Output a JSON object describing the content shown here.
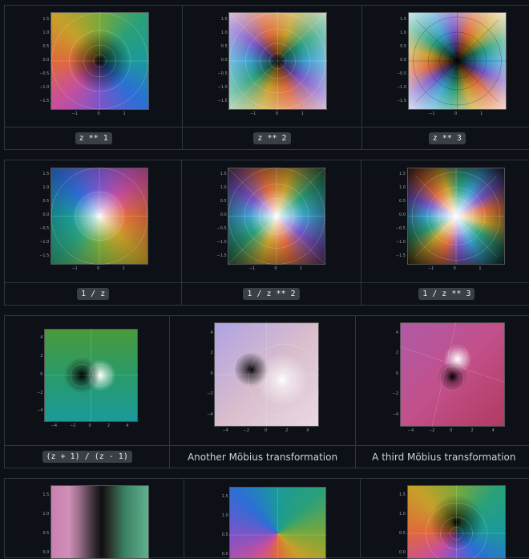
{
  "rows": [
    {
      "cells": [
        {
          "caption": "z ** 1",
          "code": true,
          "ticks_y": [
            "1.5",
            "1.0",
            "0.5",
            "0.0",
            "−0.5",
            "−1.0",
            "−1.5"
          ],
          "ticks_x": [
            "−1",
            "0",
            "1"
          ],
          "plot": "p1"
        },
        {
          "caption": "z ** 2",
          "code": true,
          "ticks_y": [
            "1.5",
            "1.0",
            "0.5",
            "0.0",
            "−0.5",
            "−1.0",
            "−1.5"
          ],
          "ticks_x": [
            "−1",
            "0",
            "1"
          ],
          "plot": "p2"
        },
        {
          "caption": "z ** 3",
          "code": true,
          "ticks_y": [
            "1.5",
            "1.0",
            "0.5",
            "0.0",
            "−0.5",
            "−1.0",
            "−1.5"
          ],
          "ticks_x": [
            "−1",
            "0",
            "1"
          ],
          "plot": "p3"
        }
      ]
    },
    {
      "cells": [
        {
          "caption": "1 / z",
          "code": true,
          "ticks_y": [
            "1.5",
            "1.0",
            "0.5",
            "0.0",
            "−0.5",
            "−1.0",
            "−1.5"
          ],
          "ticks_x": [
            "−1",
            "0",
            "1"
          ],
          "plot": "p4"
        },
        {
          "caption": "1 / z ** 2",
          "code": true,
          "ticks_y": [
            "1.5",
            "1.0",
            "0.5",
            "0.0",
            "−0.5",
            "−1.0",
            "−1.5"
          ],
          "ticks_x": [
            "−1",
            "0",
            "1"
          ],
          "plot": "p5"
        },
        {
          "caption": "1 / z ** 3",
          "code": true,
          "ticks_y": [
            "1.5",
            "1.0",
            "0.5",
            "0.0",
            "−0.5",
            "−1.0",
            "−1.5"
          ],
          "ticks_x": [
            "−1",
            "0",
            "1"
          ],
          "plot": "p6"
        }
      ]
    },
    {
      "cells": [
        {
          "caption": "(z + 1) / (z - 1)",
          "code": true,
          "ticks_y": [
            "4",
            "2",
            "0",
            "−2",
            "−4"
          ],
          "ticks_x": [
            "−4",
            "−2",
            "0",
            "2",
            "4"
          ],
          "plot": "p7"
        },
        {
          "caption": "Another Möbius transformation",
          "code": false,
          "ticks_y": [
            "4",
            "2",
            "0",
            "−2",
            "−4"
          ],
          "ticks_x": [
            "−4",
            "−2",
            "0",
            "2",
            "4"
          ],
          "plot": "p8"
        },
        {
          "caption": "A third Möbius transformation",
          "code": false,
          "ticks_y": [
            "4",
            "2",
            "0",
            "−2",
            "−4"
          ],
          "ticks_x": [
            "−4",
            "−2",
            "0",
            "2",
            "4"
          ],
          "plot": "p9"
        }
      ]
    },
    {
      "cells": [
        {
          "caption": "",
          "code": false,
          "ticks_y": [
            "1.5",
            "1.0",
            "0.5",
            "0.0",
            "−0.5"
          ],
          "ticks_x": [],
          "plot": "p10"
        },
        {
          "caption": "",
          "code": false,
          "ticks_y": [
            "1.5",
            "1.0",
            "0.5",
            "0.0",
            "−0.5"
          ],
          "ticks_x": [],
          "plot": "p11"
        },
        {
          "caption": "",
          "code": false,
          "ticks_y": [
            "1.5",
            "1.0",
            "0.5",
            "0.0",
            "−0.5"
          ],
          "ticks_x": [],
          "plot": "p12"
        }
      ]
    }
  ]
}
